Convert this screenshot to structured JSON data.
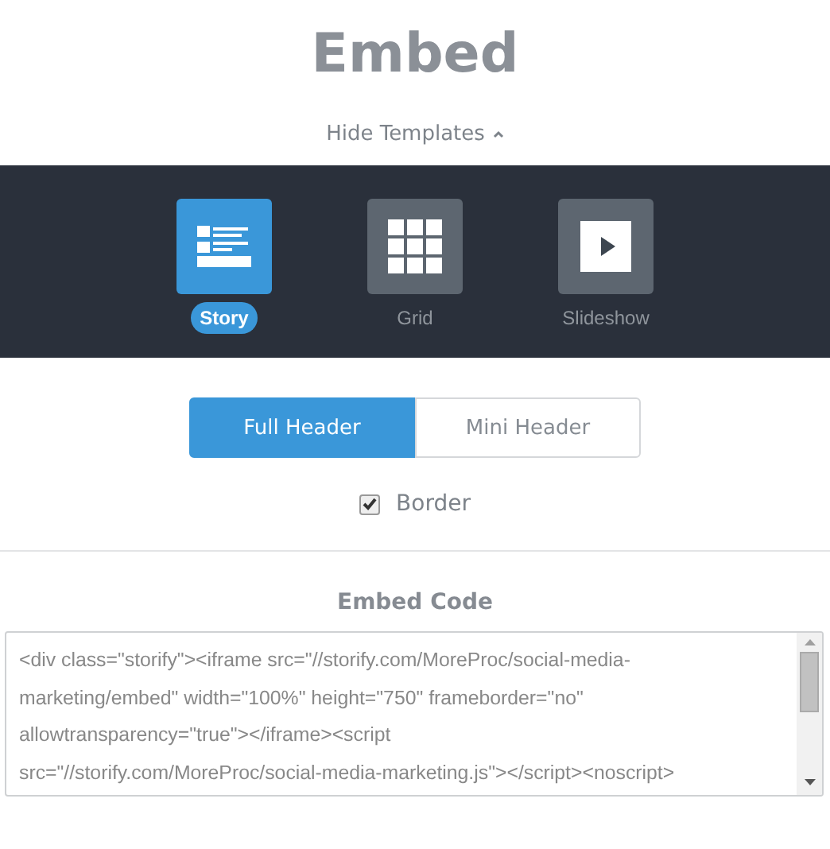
{
  "title": "Embed",
  "templates_toggle": {
    "label": "Hide Templates",
    "expanded": true
  },
  "templates": [
    {
      "kind": "story",
      "label": "Story",
      "selected": true
    },
    {
      "kind": "grid",
      "label": "Grid",
      "selected": false
    },
    {
      "kind": "slideshow",
      "label": "Slideshow",
      "selected": false
    }
  ],
  "header_options": [
    {
      "label": "Full Header",
      "selected": true
    },
    {
      "label": "Mini Header",
      "selected": false
    }
  ],
  "border": {
    "label": "Border",
    "checked": true
  },
  "embed_code": {
    "heading": "Embed Code",
    "lines": [
      "<div class=\"storify\"><iframe src=\"//storify.com/MoreProc/social-media-",
      "marketing/embed\" width=\"100%\" height=\"750\" frameborder=\"no\"",
      "allowtransparency=\"true\"></iframe><script",
      "src=\"//storify.com/MoreProc/social-media-marketing.js\"></script><noscript>"
    ]
  }
}
